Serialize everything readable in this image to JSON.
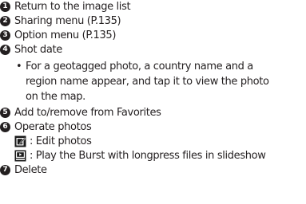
{
  "items": [
    {
      "num": "1",
      "text": "Return to the image list"
    },
    {
      "num": "2",
      "text": "Sharing menu (P.135)"
    },
    {
      "num": "3",
      "text": "Option menu (P.135)"
    },
    {
      "num": "4",
      "text": "Shot date"
    },
    {
      "num": "5",
      "text": "Add to/remove from Favorites"
    },
    {
      "num": "6",
      "text": "Operate photos"
    },
    {
      "num": "7",
      "text": "Delete"
    }
  ],
  "bullet": {
    "symbol": "•",
    "lines": [
      "For a geotagged photo, a country name and a",
      "region name appear, and tap it to view the photo",
      "on the map."
    ]
  },
  "operate": [
    {
      "icon": "edit-icon",
      "text": ": Edit photos"
    },
    {
      "icon": "slideshow-icon",
      "text": ": Play the Burst with longpress files in slideshow"
    }
  ],
  "colors": {
    "text": "#231f20",
    "icon": "#1a1a1a"
  }
}
